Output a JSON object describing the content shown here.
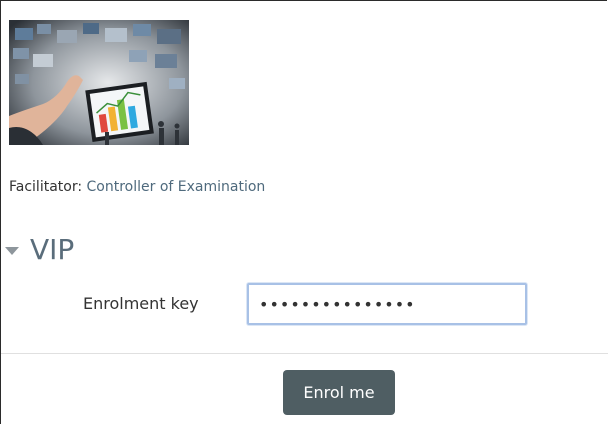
{
  "course": {
    "image_alt": "course image"
  },
  "facilitator": {
    "label": "Facilitator:",
    "name": "Controller of Examination"
  },
  "section": {
    "title": "VIP"
  },
  "enrolment": {
    "key_label": "Enrolment key",
    "key_value": "•••••••••••••••",
    "button_label": "Enrol me"
  },
  "colors": {
    "link": "#4f6a7d",
    "section_title": "#5a6d7b",
    "button_bg": "#4f5e63",
    "input_focus_border": "#a8c1e6"
  }
}
